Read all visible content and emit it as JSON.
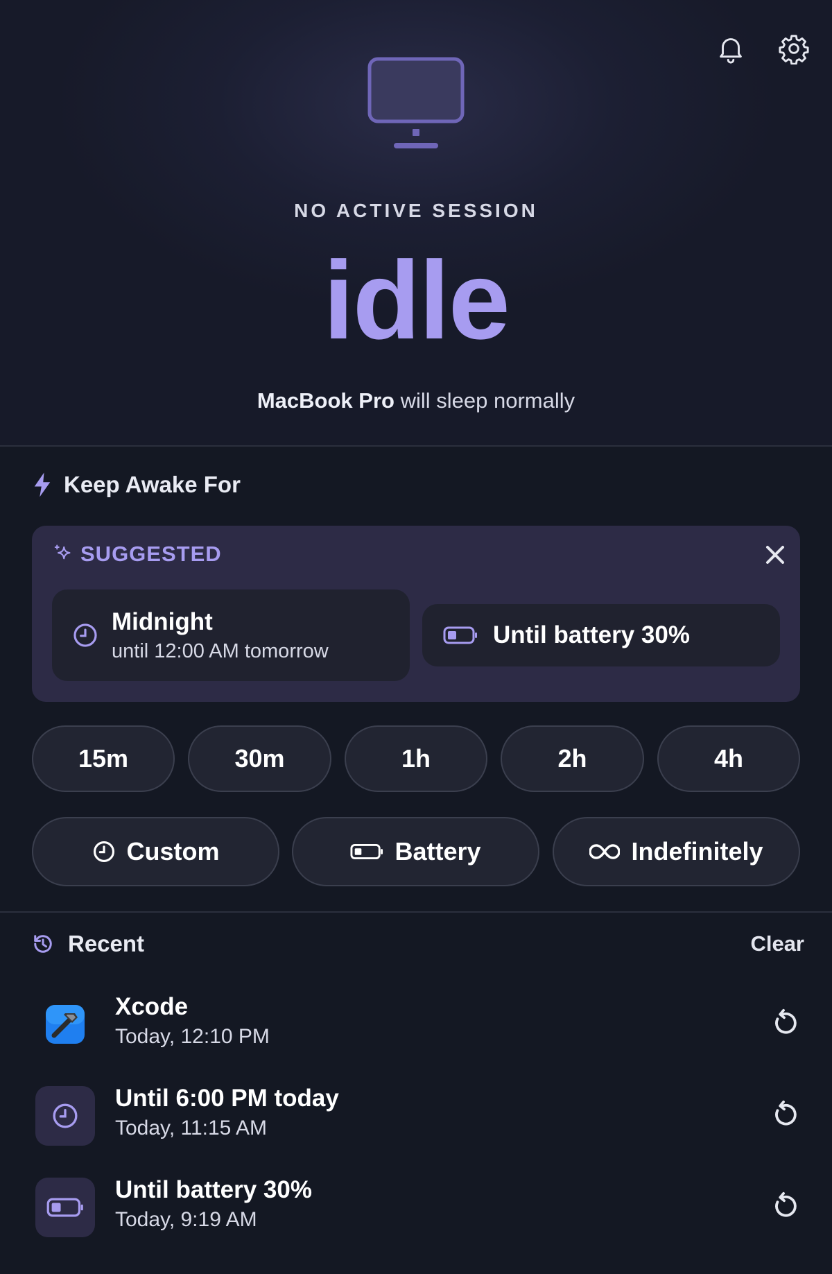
{
  "header": {
    "icons": [
      "bell-icon",
      "gear-icon"
    ],
    "monitor_icon": "display-icon"
  },
  "status": {
    "label": "NO ACTIVE SESSION",
    "state": "idle",
    "device_name": "MacBook Pro",
    "device_suffix": "will sleep normally"
  },
  "keep_awake": {
    "title": "Keep Awake For",
    "icon": "bolt-icon",
    "suggested": {
      "label": "SUGGESTED",
      "cards": [
        {
          "title": "Midnight",
          "subtitle": "until 12:00 AM tomorrow",
          "icon": "clock-icon"
        },
        {
          "title": "Until battery 30%",
          "icon": "battery-icon"
        }
      ]
    },
    "durations": [
      "15m",
      "30m",
      "1h",
      "2h",
      "4h"
    ],
    "modes": [
      {
        "label": "Custom",
        "icon": "clock-icon"
      },
      {
        "label": "Battery",
        "icon": "battery-icon"
      },
      {
        "label": "Indefinitely",
        "icon": "infinity-icon"
      }
    ]
  },
  "recent": {
    "title": "Recent",
    "clear_label": "Clear",
    "items": [
      {
        "title": "Xcode",
        "time": "Today, 12:10 PM",
        "icon": "xcode-app-icon"
      },
      {
        "title": "Until 6:00 PM today",
        "time": "Today, 11:15 AM",
        "icon": "clock-icon"
      },
      {
        "title": "Until battery 30%",
        "time": "Today, 9:19 AM",
        "icon": "battery-icon"
      }
    ]
  },
  "colors": {
    "accent": "#a79cf0",
    "background": "#141823",
    "panel": "#2d2b46",
    "pill": "#222532"
  }
}
